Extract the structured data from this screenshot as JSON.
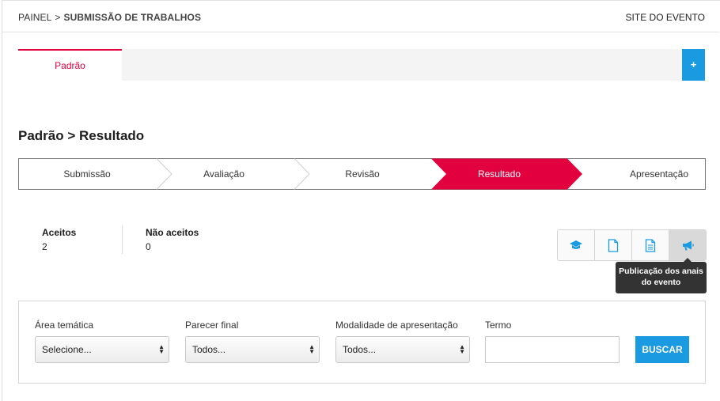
{
  "header": {
    "breadcrumb_root": "PAINEL",
    "breadcrumb_sep": ">",
    "breadcrumb_current": "SUBMISSÃO DE TRABALHOS",
    "site_link": "SITE DO EVENTO"
  },
  "tabs": {
    "active_label": "Padrão",
    "add_label": "+"
  },
  "page": {
    "title": "Padrão > Resultado"
  },
  "steps": [
    {
      "label": "Submissão",
      "active": false
    },
    {
      "label": "Avaliação",
      "active": false
    },
    {
      "label": "Revisão",
      "active": false
    },
    {
      "label": "Resultado",
      "active": true
    },
    {
      "label": "Apresentação",
      "active": false
    }
  ],
  "stats": {
    "accepted_label": "Aceitos",
    "accepted_value": "2",
    "rejected_label": "Não aceitos",
    "rejected_value": "0"
  },
  "actions": {
    "icons": [
      "graduation-cap-icon",
      "file-icon",
      "file-text-icon",
      "megaphone-icon"
    ],
    "tooltip": "Publicação dos anais do evento"
  },
  "filters": {
    "area_label": "Área temática",
    "area_value": "Selecione...",
    "parecer_label": "Parecer final",
    "parecer_value": "Todos...",
    "modalidade_label": "Modalidade de apresentação",
    "modalidade_value": "Todos...",
    "termo_label": "Termo",
    "termo_value": "",
    "search_label": "BUSCAR"
  },
  "colors": {
    "accent_red": "#e3003e",
    "accent_blue": "#1a9ae0"
  }
}
